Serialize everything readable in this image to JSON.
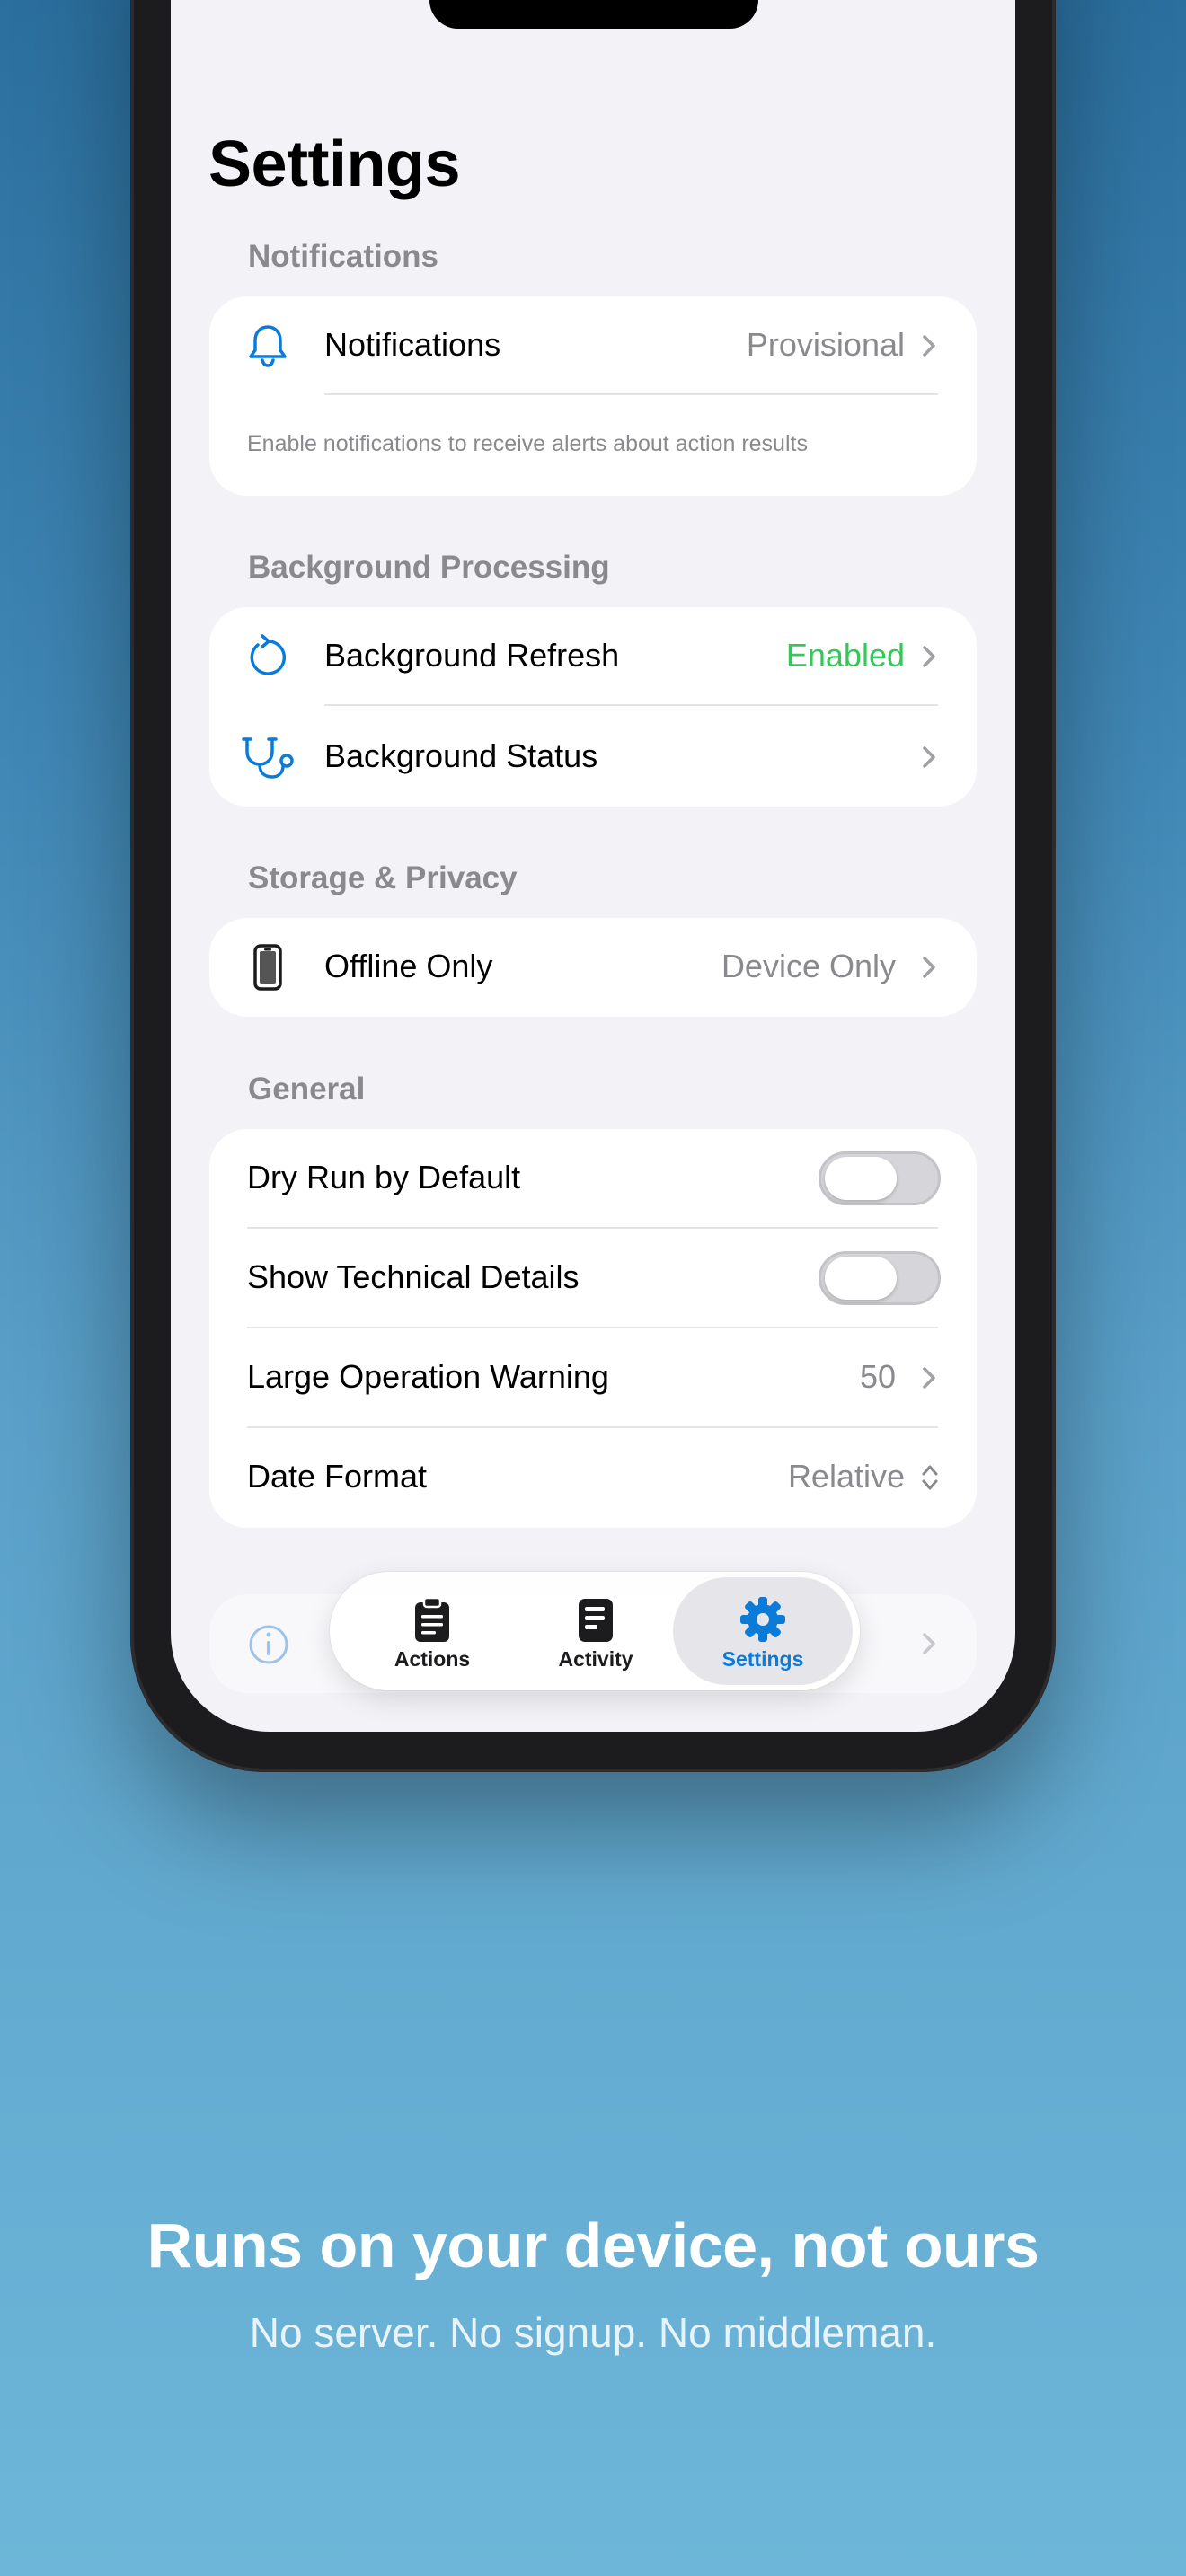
{
  "screen": {
    "title": "Settings"
  },
  "sections": {
    "notifications": {
      "header": "Notifications",
      "row_label": "Notifications",
      "row_value": "Provisional",
      "footnote": "Enable notifications to receive alerts about action results"
    },
    "background": {
      "header": "Background Processing",
      "refresh_label": "Background Refresh",
      "refresh_value": "Enabled",
      "status_label": "Background Status"
    },
    "storage": {
      "header": "Storage & Privacy",
      "offline_label": "Offline Only",
      "offline_value": "Device Only"
    },
    "general": {
      "header": "General",
      "dry_run_label": "Dry Run by Default",
      "dry_run_on": false,
      "tech_details_label": "Show Technical Details",
      "tech_details_on": false,
      "large_op_label": "Large Operation Warning",
      "large_op_value": "50",
      "date_format_label": "Date Format",
      "date_format_value": "Relative"
    }
  },
  "tabbar": {
    "tabs": [
      {
        "label": "Actions",
        "icon": "clipboard-icon"
      },
      {
        "label": "Activity",
        "icon": "document-icon"
      },
      {
        "label": "Settings",
        "icon": "gear-icon",
        "active": true
      }
    ]
  },
  "marketing": {
    "headline": "Runs on your device, not ours",
    "subline": "No server. No signup. No middleman."
  },
  "colors": {
    "accent": "#0a7bd8",
    "enabled_green": "#34c759",
    "secondary_text": "#8a8a8e"
  }
}
